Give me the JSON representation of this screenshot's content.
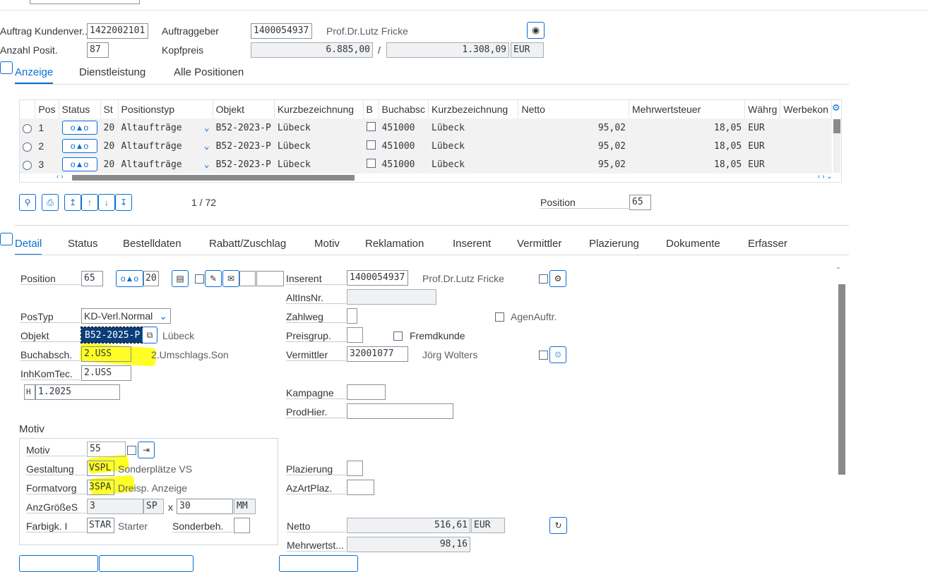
{
  "header": {
    "auftrag_label": "Auftrag Kundenver...",
    "auftrag_value": "1422002101",
    "auftraggeber_label": "Auftraggeber",
    "auftraggeber_value": "1400054937",
    "auftraggeber_name": "Prof.Dr.Lutz Fricke",
    "anzahl_label": "Anzahl Posit.",
    "anzahl_value": "87",
    "kopfpreis_label": "Kopfpreis",
    "kopfpreis_value": "6.885,00",
    "slash": "/",
    "kopfpreis2_value": "1.308,09",
    "currency": "EUR"
  },
  "top_tabs": [
    "Anzeige",
    "Dienstleistung",
    "Alle Positionen"
  ],
  "table": {
    "columns": [
      "Pos",
      "Status",
      "St",
      "Positionstyp",
      "Objekt",
      "Kurzbezeichnung",
      "B",
      "Buchabsc",
      "Kurzbezeichnung",
      "Netto",
      "Mehrwertsteuer",
      "Währg",
      "Werbekon"
    ],
    "rows": [
      {
        "pos": "1",
        "st": "20",
        "typ": "Altaufträge",
        "objekt": "B52-2023-P",
        "kurz": "Lübeck",
        "buch": "451000",
        "kurz2": "Lübeck",
        "netto": "95,02",
        "mwst": "18,05",
        "waehrung": "EUR"
      },
      {
        "pos": "2",
        "st": "20",
        "typ": "Altaufträge",
        "objekt": "B52-2023-P",
        "kurz": "Lübeck",
        "buch": "451000",
        "kurz2": "Lübeck",
        "netto": "95,02",
        "mwst": "18,05",
        "waehrung": "EUR"
      },
      {
        "pos": "3",
        "st": "20",
        "typ": "Altaufträge",
        "objekt": "B52-2023-P",
        "kurz": "Lübeck",
        "buch": "451000",
        "kurz2": "Lübeck",
        "netto": "95,02",
        "mwst": "18,05",
        "waehrung": "EUR"
      }
    ],
    "status_icon": "ο▲ο",
    "paging": "1 / 72",
    "position_label": "Position",
    "position_value": "65"
  },
  "detail_tabs": [
    "Detail",
    "Status",
    "Bestelldaten",
    "Rabatt/Zuschlag",
    "Motiv",
    "Reklamation",
    "Inserent",
    "Vermittler",
    "Plazierung",
    "Dokumente",
    "Erfasser"
  ],
  "detail": {
    "position_label": "Position",
    "position_value": "65",
    "status_value": "20",
    "postyp_label": "PosTyp",
    "postyp_value": "KD-Verl.Normal",
    "objekt_label": "Objekt",
    "objekt_value": "B52-2025-P",
    "objekt_text": "Lübeck",
    "buchabsch_label": "Buchabsch.",
    "buchabsch_value": "2.USS",
    "buchabsch_text": "2.Umschlags.Son",
    "inhkomtec_label": "InhKomTec.",
    "inhkomtec_value": "2.USS",
    "h_value": "H",
    "period_value": "1.2025",
    "inserent_label": "Inserent",
    "inserent_value": "1400054937",
    "inserent_name": "Prof.Dr.Lutz Fricke",
    "altinsnr_label": "AltInsNr.",
    "zahlweg_label": "Zahlweg",
    "agenauftr_label": "AgenAuftr.",
    "preisgrup_label": "Preisgrup.",
    "fremdkunde_label": "Fremdkunde",
    "vermittler_label": "Vermittler",
    "vermittler_value": "32001077",
    "vermittler_name": "Jörg Wolters",
    "kampagne_label": "Kampagne",
    "prodhier_label": "ProdHier."
  },
  "motiv": {
    "section_title": "Motiv",
    "motiv_label": "Motiv",
    "motiv_value": "55",
    "gestaltung_label": "Gestaltung",
    "gestaltung_value": "VSPL",
    "gestaltung_text": "Sonderplätze VS",
    "formatvorg_label": "Formatvorg",
    "formatvorg_value": "3SPA",
    "formatvorg_text": "Dreisp. Anzeige",
    "anzgroesse_label": "AnzGrößeS",
    "anzgroesse_value": "3",
    "anzgroesse_unit": "SP",
    "times": "x",
    "anzgroesse_value2": "30",
    "anzgroesse_unit2": "MM",
    "farbigk_label": "Farbigk. I",
    "farbigk_value": "STAR",
    "farbigk_text": "Starter",
    "sonderbeh_label": "Sonderbeh.",
    "plazierung_label": "Plazierung",
    "azartplaz_label": "AzArtPlaz.",
    "netto_label": "Netto",
    "netto_value": "516,61",
    "netto_currency": "EUR",
    "mwst_label": "Mehrwertst...",
    "mwst_value": "98,16"
  },
  "colors": {
    "accent": "#0a6ed1",
    "highlight": "#ffff00",
    "selection": "#0a3e78"
  }
}
